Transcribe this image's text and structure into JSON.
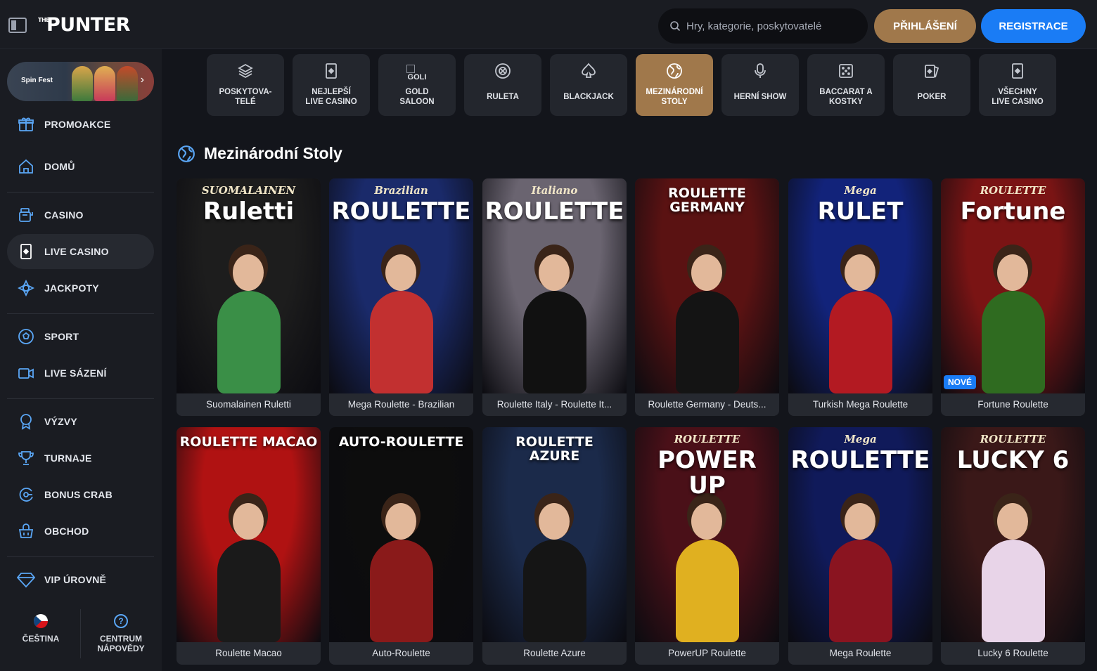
{
  "header": {
    "logo_prefix": "THE",
    "logo_text": "PUNTER",
    "search_placeholder": "Hry, kategorie, poskytovatelé",
    "login_label": "PŘIHLÁŠENÍ",
    "register_label": "REGISTRACE"
  },
  "sidebar": {
    "promo_banner_label": "Spin Fest",
    "items": [
      {
        "label": "PROMOAKCE",
        "icon": "gift-icon"
      },
      {
        "label": "DOMŮ",
        "icon": "home-icon"
      },
      {
        "label": "CASINO",
        "icon": "slot-machine-icon"
      },
      {
        "label": "LIVE CASINO",
        "icon": "live-card-icon"
      },
      {
        "label": "JACKPOTY",
        "icon": "jackpot-icon"
      },
      {
        "label": "SPORT",
        "icon": "football-icon"
      },
      {
        "label": "LIVE SÁZENÍ",
        "icon": "video-camera-icon"
      },
      {
        "label": "VÝZVY",
        "icon": "badge-icon"
      },
      {
        "label": "TURNAJE",
        "icon": "trophy-icon"
      },
      {
        "label": "BONUS CRAB",
        "icon": "bonus-crab-icon"
      },
      {
        "label": "OBCHOD",
        "icon": "shop-basket-icon"
      },
      {
        "label": "VIP ÚROVNĚ",
        "icon": "diamond-icon"
      }
    ],
    "footer": {
      "language_label": "ČEŠTINA",
      "help_label": "CENTRUM\nNÁPOVĚDY"
    }
  },
  "categories": [
    {
      "label": "POSKYTOVA-\nTELÉ",
      "icon": "layers-icon",
      "active": false
    },
    {
      "label": "NEJLEPŠÍ\nLIVE CASINO",
      "icon": "card-icon",
      "active": false
    },
    {
      "label": "GOLD\nSALOON",
      "icon": "broken-image-icon",
      "alt": "GOLI",
      "active": false
    },
    {
      "label": "RULETA",
      "icon": "roulette-icon",
      "active": false
    },
    {
      "label": "BLACKJACK",
      "icon": "spade-icon",
      "active": false
    },
    {
      "label": "MEZINÁRODNÍ\nSTOLY",
      "icon": "globe-icon",
      "active": true
    },
    {
      "label": "HERNÍ SHOW",
      "icon": "microphone-icon",
      "active": false
    },
    {
      "label": "BACCARAT A\nKOSTKY",
      "icon": "dice-icon",
      "active": false
    },
    {
      "label": "POKER",
      "icon": "poker-cards-icon",
      "active": false
    },
    {
      "label": "VŠECHNY\nLIVE CASINO",
      "icon": "card-icon",
      "active": false
    }
  ],
  "section": {
    "title": "Mezinárodní Stoly"
  },
  "games": [
    {
      "name": "Suomalainen Ruletti",
      "art_title": "Ruletti",
      "art_sub": "SUOMALAINEN",
      "bg": "#1d1d1d",
      "accent": "#3a8f47"
    },
    {
      "name": "Mega Roulette - Brazilian",
      "art_title": "ROULETTE",
      "art_sub": "Brazilian",
      "bg": "#1a2a6a",
      "accent": "#c23030"
    },
    {
      "name": "Roulette Italy - Roulette It...",
      "art_title": "ROULETTE",
      "art_sub": "Italiano",
      "bg": "#6a6470",
      "accent": "#111111"
    },
    {
      "name": "Roulette Germany - Deuts...",
      "art_title": "ROULETTE GERMANY",
      "art_sub": "",
      "bg": "#5a1212",
      "accent": "#141414"
    },
    {
      "name": "Turkish Mega Roulette",
      "art_title": "RULET",
      "art_sub": "Mega",
      "bg": "#12237a",
      "accent": "#b31a22"
    },
    {
      "name": "Fortune Roulette",
      "art_title": "Fortune",
      "art_sub": "ROULETTE",
      "bg": "#7a1414",
      "accent": "#2f6b20",
      "badge": "NOVÉ"
    },
    {
      "name": "Roulette Macao",
      "art_title": "ROULETTE MACAO",
      "art_sub": "",
      "bg": "#b01212",
      "accent": "#1a1a1a"
    },
    {
      "name": "Auto-Roulette",
      "art_title": "AUTO-ROULETTE",
      "art_sub": "",
      "bg": "#0d0d0d",
      "accent": "#8a1a1a"
    },
    {
      "name": "Roulette Azure",
      "art_title": "ROULETTE\nAZURE",
      "art_sub": "",
      "bg": "#1b2a4a",
      "accent": "#151515"
    },
    {
      "name": "PowerUP Roulette",
      "art_title": "POWER UP",
      "art_sub": "ROULETTE",
      "bg": "#4a1018",
      "accent": "#e0b020"
    },
    {
      "name": "Mega Roulette",
      "art_title": "ROULETTE",
      "art_sub": "Mega",
      "bg": "#101a5a",
      "accent": "#8a1420"
    },
    {
      "name": "Lucky 6 Roulette",
      "art_title": "LUCKY 6",
      "art_sub": "ROULETTE",
      "bg": "#3a1818",
      "accent": "#e8d4e8"
    }
  ]
}
